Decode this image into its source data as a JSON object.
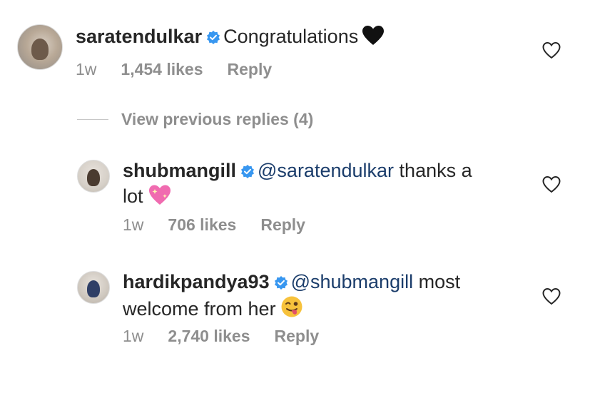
{
  "comments": [
    {
      "username": "saratendulkar",
      "text": "Congratulations",
      "emoji": "black-heart",
      "time": "1w",
      "likes": "1,454 likes",
      "reply": "Reply"
    },
    {
      "username": "shubmangill",
      "mention": "@saratendulkar",
      "text_line1": "thanks a",
      "text_line2": "lot",
      "emoji": "sparkling-heart",
      "time": "1w",
      "likes": "706 likes",
      "reply": "Reply"
    },
    {
      "username": "hardikpandya93",
      "mention": "@shubmangill",
      "text_line1": "most",
      "text_line2": "welcome from her",
      "emoji": "winking-face-with-tongue",
      "time": "1w",
      "likes": "2,740 likes",
      "reply": "Reply"
    }
  ],
  "view_previous_replies": "View previous replies (4)",
  "colors": {
    "verified": "#3897f0",
    "meta": "#8e8e8e",
    "mention": "#1b3d6b"
  }
}
